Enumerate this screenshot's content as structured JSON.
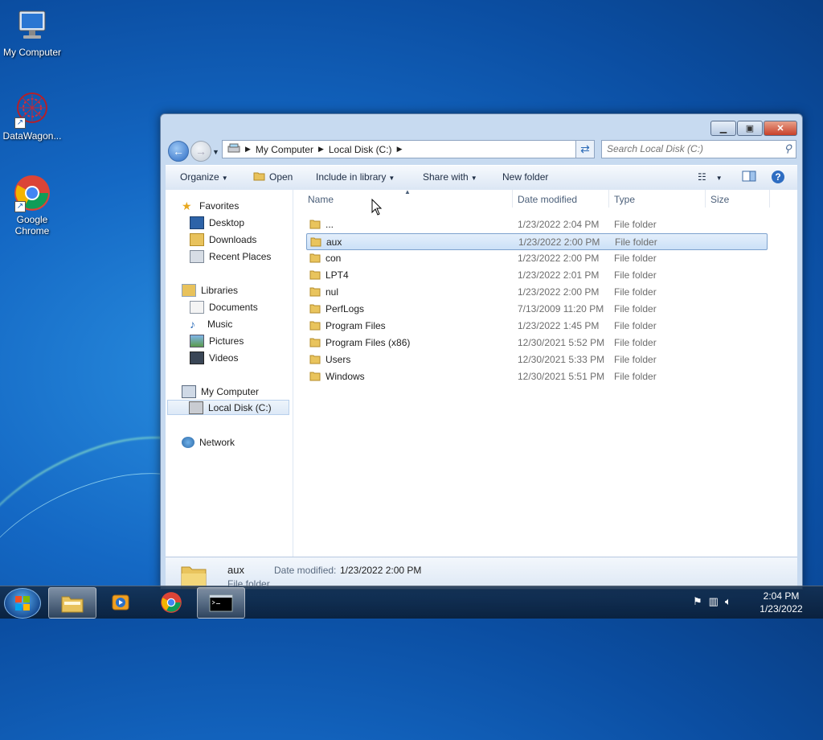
{
  "desktop": {
    "icons": [
      {
        "label": "My Computer"
      },
      {
        "label": "DataWagon..."
      },
      {
        "label": "Google Chrome"
      }
    ]
  },
  "window": {
    "address": {
      "crumbs": [
        "My Computer",
        "Local Disk (C:)"
      ]
    },
    "search": {
      "placeholder": "Search Local Disk (C:)"
    },
    "toolbar": {
      "organize": "Organize",
      "open": "Open",
      "include_in_library": "Include in library",
      "share_with": "Share with",
      "new_folder": "New folder"
    },
    "nav": {
      "favorites": "Favorites",
      "desktop": "Desktop",
      "downloads": "Downloads",
      "recent_places": "Recent Places",
      "libraries": "Libraries",
      "documents": "Documents",
      "music": "Music",
      "pictures": "Pictures",
      "videos": "Videos",
      "my_computer": "My Computer",
      "local_disk": "Local Disk (C:)",
      "network": "Network"
    },
    "columns": {
      "name": "Name",
      "date": "Date modified",
      "type": "Type",
      "size": "Size"
    },
    "files": [
      {
        "name": "...",
        "date": "1/23/2022 2:04 PM",
        "type": "File folder"
      },
      {
        "name": "aux",
        "date": "1/23/2022 2:00 PM",
        "type": "File folder"
      },
      {
        "name": "con",
        "date": "1/23/2022 2:00 PM",
        "type": "File folder"
      },
      {
        "name": "LPT4",
        "date": "1/23/2022 2:01 PM",
        "type": "File folder"
      },
      {
        "name": "nul",
        "date": "1/23/2022 2:00 PM",
        "type": "File folder"
      },
      {
        "name": "PerfLogs",
        "date": "7/13/2009 11:20 PM",
        "type": "File folder"
      },
      {
        "name": "Program Files",
        "date": "1/23/2022 1:45 PM",
        "type": "File folder"
      },
      {
        "name": "Program Files (x86)",
        "date": "12/30/2021 5:52 PM",
        "type": "File folder"
      },
      {
        "name": "Users",
        "date": "12/30/2021 5:33 PM",
        "type": "File folder"
      },
      {
        "name": "Windows",
        "date": "12/30/2021 5:51 PM",
        "type": "File folder"
      }
    ],
    "details": {
      "name": "aux",
      "type": "File folder",
      "date_label": "Date modified:",
      "date_value": "1/23/2022 2:00 PM"
    }
  },
  "taskbar": {
    "time": "2:04 PM",
    "date": "1/23/2022"
  },
  "colors": {
    "selection": "#cbe0f7",
    "accent": "#1468c4"
  }
}
